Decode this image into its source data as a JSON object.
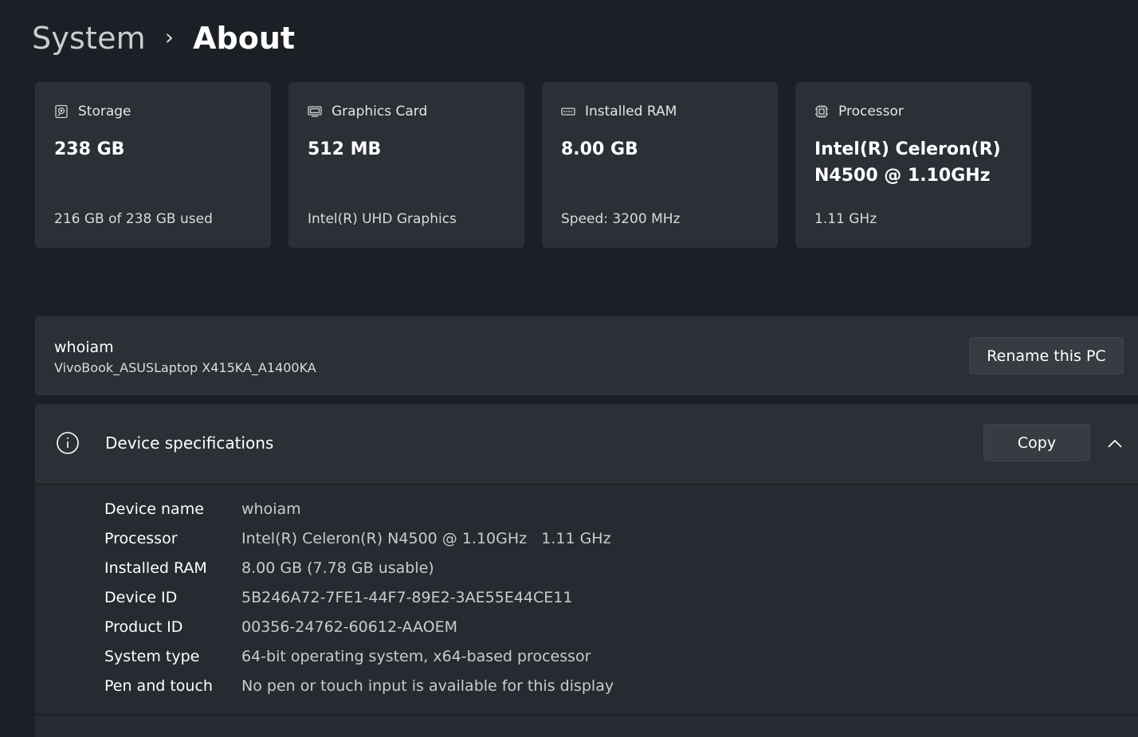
{
  "breadcrumb": {
    "parent": "System",
    "separator": "›",
    "current": "About"
  },
  "cards": [
    {
      "icon": "storage-icon",
      "label": "Storage",
      "value": "238 GB",
      "sub": "216 GB of 238 GB used"
    },
    {
      "icon": "graphics-card-icon",
      "label": "Graphics Card",
      "value": "512 MB",
      "sub": "Intel(R) UHD Graphics"
    },
    {
      "icon": "ram-icon",
      "label": "Installed RAM",
      "value": "8.00 GB",
      "sub": "Speed: 3200 MHz"
    },
    {
      "icon": "processor-icon",
      "label": "Processor",
      "value": "Intel(R) Celeron(R) N4500 @ 1.10GHz",
      "sub": "1.11 GHz"
    }
  ],
  "pc": {
    "name": "whoiam",
    "model": "VivoBook_ASUSLaptop X415KA_A1400KA",
    "rename_label": "Rename this PC"
  },
  "specs": {
    "title": "Device specifications",
    "copy_label": "Copy",
    "rows": [
      {
        "key": "Device name",
        "value": "whoiam"
      },
      {
        "key": "Processor",
        "value": "Intel(R) Celeron(R) N4500 @ 1.10GHz   1.11 GHz"
      },
      {
        "key": "Installed RAM",
        "value": "8.00 GB (7.78 GB usable)"
      },
      {
        "key": "Device ID",
        "value": "5B246A72-7FE1-44F7-89E2-3AE55E44CE11"
      },
      {
        "key": "Product ID",
        "value": "00356-24762-60612-AAOEM"
      },
      {
        "key": "System type",
        "value": "64-bit operating system, x64-based processor"
      },
      {
        "key": "Pen and touch",
        "value": "No pen or touch input is available for this display"
      }
    ]
  }
}
